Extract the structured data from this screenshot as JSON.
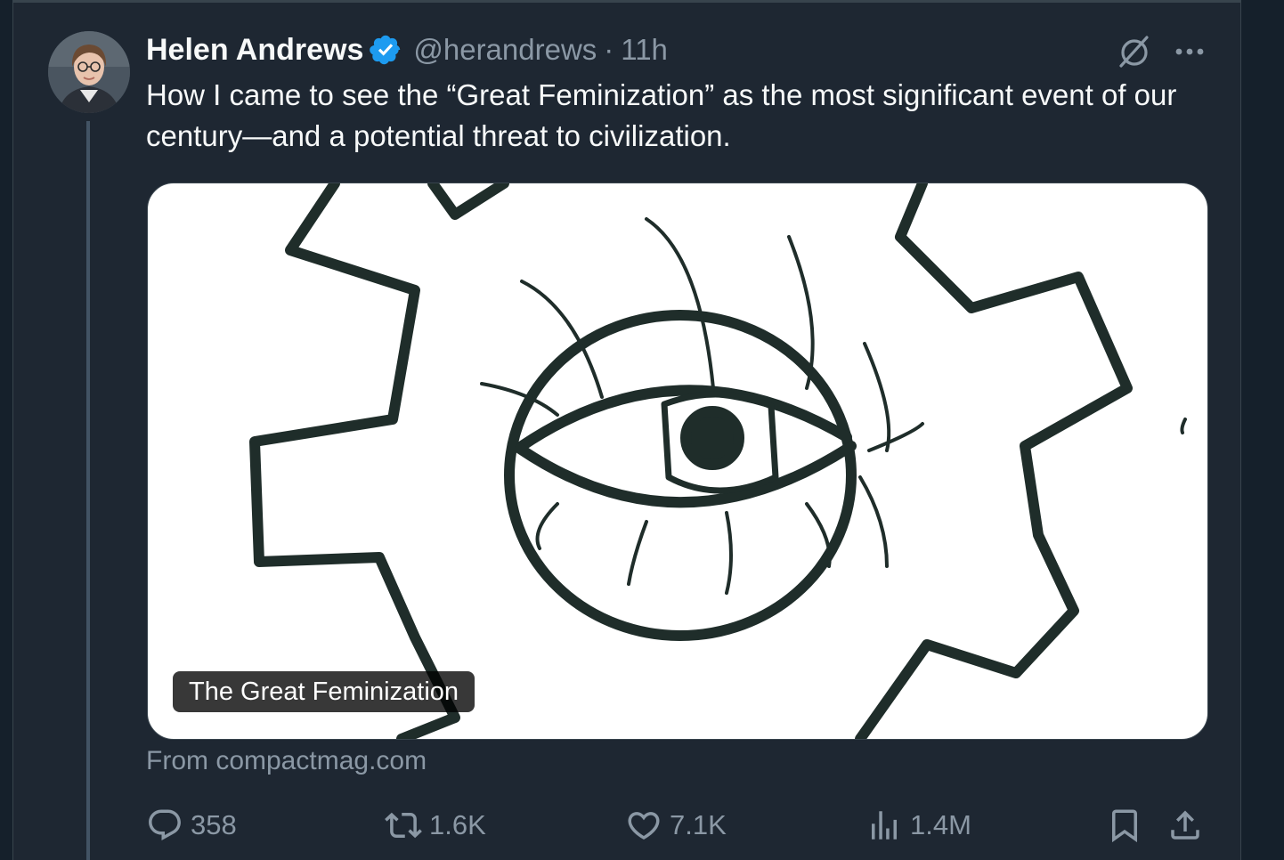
{
  "tweet": {
    "author_name": "Helen Andrews",
    "handle": "@herandrews",
    "separator": "·",
    "time": "11h",
    "text": "How I came to see the “Great Feminization” as the most significant event of our century—and a potential threat to civilization.",
    "card": {
      "label": "The Great Feminization",
      "source": "From compactmag.com"
    },
    "actions": {
      "replies": "358",
      "reposts": "1.6K",
      "likes": "7.1K",
      "views": "1.4M"
    }
  },
  "colors": {
    "background": "#15202b",
    "card_column": "#1e2732",
    "text_primary": "#f7f9f9",
    "text_secondary": "#8b98a5",
    "verified_blue": "#1d9bf0",
    "art_stroke": "#1f2d2a"
  },
  "icons": {
    "verified": "verified-badge-icon",
    "grok": "grok-icon",
    "more": "more-icon",
    "reply": "reply-icon",
    "repost": "repost-icon",
    "like": "like-icon",
    "views": "views-icon",
    "bookmark": "bookmark-icon",
    "share": "share-icon"
  }
}
